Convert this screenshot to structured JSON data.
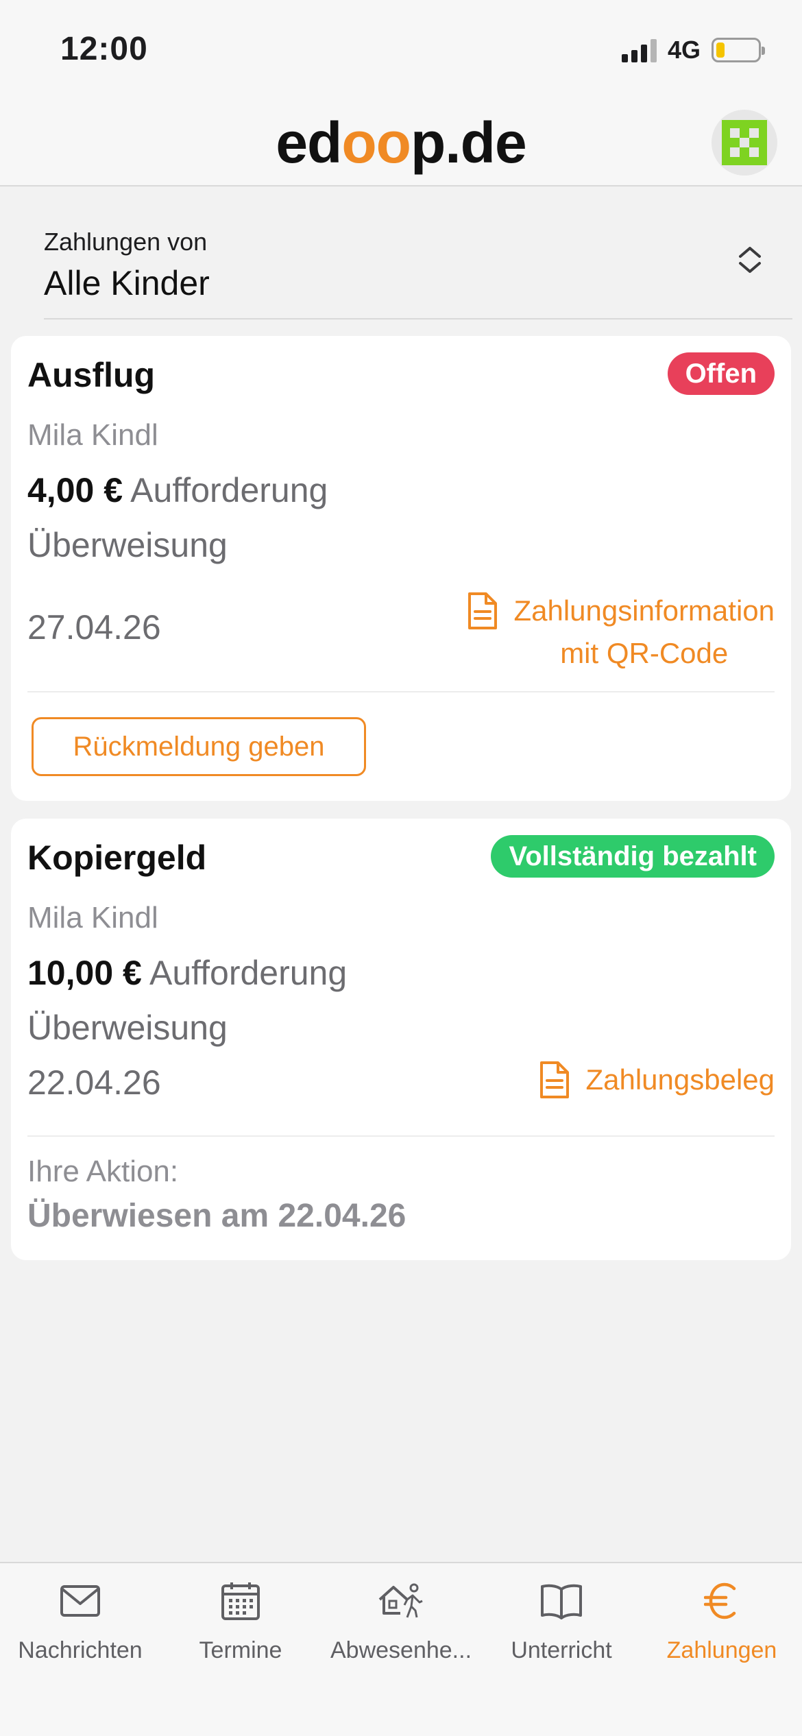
{
  "status_bar": {
    "time": "12:00",
    "network": "4G"
  },
  "header": {
    "logo_prefix": "ed",
    "logo_oo": "oo",
    "logo_suffix": "p.de"
  },
  "filter": {
    "label": "Zahlungen von",
    "value": "Alle Kinder"
  },
  "payments": [
    {
      "title": "Ausflug",
      "status": "Offen",
      "status_color": "#e8405a",
      "child": "Mila Kindl",
      "amount": "4,00 €",
      "amount_suffix": "Aufforderung",
      "method": "Überweisung",
      "date": "27.04.26",
      "link_line1": "Zahlungsinformation",
      "link_line2": "mit QR-Code",
      "button": "Rückmeldung geben"
    },
    {
      "title": "Kopiergeld",
      "status": "Vollständig bezahlt",
      "status_color": "#2ecb6b",
      "child": "Mila Kindl",
      "amount": "10,00 €",
      "amount_suffix": "Aufforderung",
      "method": "Überweisung",
      "date": "22.04.26",
      "link": "Zahlungsbeleg",
      "action_label": "Ihre Aktion:",
      "action_value": "Überwiesen am 22.04.26"
    }
  ],
  "tabs": [
    {
      "label": "Nachrichten",
      "icon": "envelope-icon"
    },
    {
      "label": "Termine",
      "icon": "calendar-icon"
    },
    {
      "label": "Abwesenhe...",
      "icon": "absence-icon"
    },
    {
      "label": "Unterricht",
      "icon": "book-icon"
    },
    {
      "label": "Zahlungen",
      "icon": "euro-icon",
      "active": true
    }
  ],
  "colors": {
    "accent": "#f08a24",
    "open": "#e8405a",
    "paid": "#2ecb6b"
  }
}
